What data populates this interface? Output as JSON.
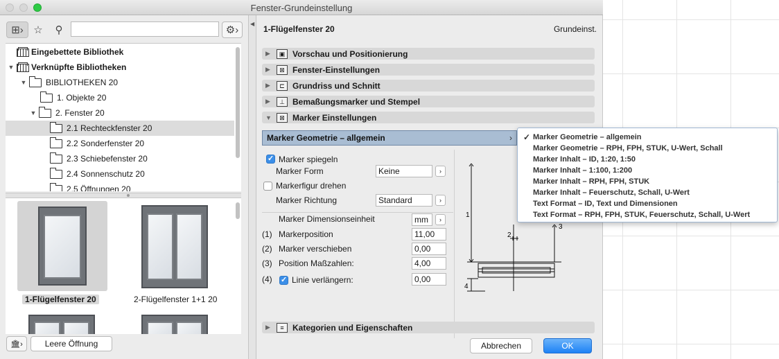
{
  "window": {
    "title": "Fenster-Grundeinstellung"
  },
  "left_panel": {
    "tree": [
      {
        "label": "Eingebettete Bibliothek",
        "bold": true,
        "icon": "library-icon"
      },
      {
        "label": "Verknüpfte Bibliotheken",
        "bold": true,
        "icon": "library-icon"
      },
      {
        "label": "BIBLIOTHEKEN 20"
      },
      {
        "label": "1. Objekte 20"
      },
      {
        "label": "2. Fenster 20"
      },
      {
        "label": "2.1 Rechteckfenster 20",
        "selected": true
      },
      {
        "label": "2.2 Sonderfenster 20"
      },
      {
        "label": "2.3 Schiebefenster 20"
      },
      {
        "label": "2.4 Sonnenschutz 20"
      },
      {
        "label": "2.5 Öffnungen 20"
      }
    ],
    "thumbnails": [
      {
        "label": "1-Flügelfenster 20",
        "selected": true
      },
      {
        "label": "2-Flügelfenster 1+1 20"
      }
    ],
    "empty_opening_button": "Leere Öffnung"
  },
  "right_panel": {
    "object_title": "1-Flügelfenster 20",
    "preset": "Grundeinst.",
    "sections": [
      "Vorschau und Positionierung",
      "Fenster-Einstellungen",
      "Grundriss und Schnitt",
      "Bemaßungsmarker und Stempel",
      "Marker Einstellungen"
    ],
    "dropdown_selected": "Marker Geometrie – allgemein",
    "params": {
      "mirror_label": "Marker spiegeln",
      "form_label": "Marker Form",
      "form_value": "Keine",
      "rotate_label": "Markerfigur drehen",
      "direction_label": "Marker Richtung",
      "direction_value": "Standard",
      "dim_unit_label": "Marker Dimensionseinheit",
      "dim_unit_value": "mm",
      "position_index": "(1)",
      "position_label": "Markerposition",
      "position_value": "11,00",
      "shift_index": "(2)",
      "shift_label": "Marker verschieben",
      "shift_value": "0,00",
      "dimpos_index": "(3)",
      "dimpos_label": "Position Maßzahlen:",
      "dimpos_value": "4,00",
      "extend_index": "(4)",
      "extend_label": "Linie verlängern:",
      "extend_value": "0,00"
    },
    "diagram_labels": {
      "l1": "1",
      "l2": "2",
      "l3": "3",
      "l4": "4"
    },
    "bottom_section": "Kategorien und Eigenschaften",
    "cancel_button": "Abbrechen",
    "ok_button": "OK"
  },
  "popup_menu": {
    "items": [
      {
        "label": "Marker Geometrie – allgemein",
        "checked": true
      },
      {
        "label": "Marker Geometrie – RPH, FPH, STUK, U-Wert, Schall"
      },
      {
        "label": "Marker Inhalt – ID, 1:20, 1:50"
      },
      {
        "label": "Marker Inhalt – 1:100, 1:200"
      },
      {
        "label": "Marker Inhalt – RPH, FPH, STUK"
      },
      {
        "label": "Marker Inhalt – Feuerschutz, Schall, U-Wert"
      },
      {
        "label": "Text Format – ID, Text und Dimensionen"
      },
      {
        "label": "Text Format – RPH, FPH, STUK, Feuerschutz, Schall, U-Wert"
      }
    ]
  }
}
